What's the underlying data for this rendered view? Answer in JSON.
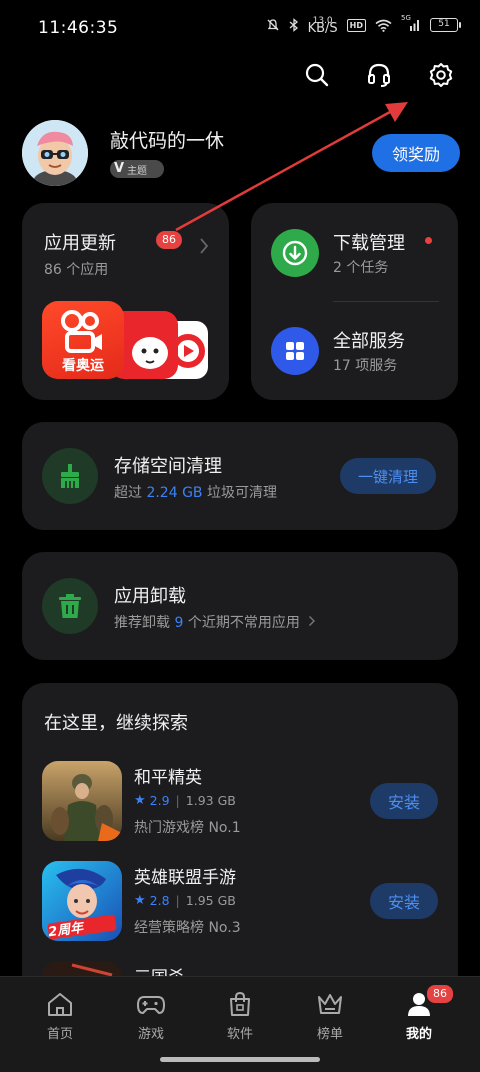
{
  "status_bar": {
    "time": "11:46:35",
    "net_speed_value": "13.0",
    "net_speed_unit": "KB/S",
    "hd": "HD",
    "net_type": "5G",
    "battery": "51"
  },
  "top_actions": {
    "icons": [
      "search-icon",
      "headset-icon",
      "gear-icon"
    ]
  },
  "profile": {
    "username": "敲代码的一休",
    "badge_letter": "V",
    "badge_label": "主题",
    "reward_button": "领奖励"
  },
  "updates_card": {
    "title": "应用更新",
    "count": "86",
    "subtitle": "86 个应用",
    "tile_text": "看奥运"
  },
  "downloads": {
    "title": "下载管理",
    "subtitle": "2 个任务"
  },
  "services": {
    "title": "全部服务",
    "subtitle": "17 项服务"
  },
  "storage": {
    "title": "存储空间清理",
    "sub_prefix": "超过",
    "sub_value": "2.24 GB",
    "sub_suffix": "垃圾可清理",
    "button": "一键清理"
  },
  "uninstall": {
    "title": "应用卸载",
    "sub_prefix": "推荐卸载",
    "sub_value": "9",
    "sub_suffix": "个近期不常用应用"
  },
  "explore": {
    "title": "在这里，继续探索",
    "games": [
      {
        "name": "和平精英",
        "rating": "2.9",
        "size": "1.93 GB",
        "rank": "热门游戏榜 No.1",
        "button": "安装"
      },
      {
        "name": "英雄联盟手游",
        "rating": "2.8",
        "size": "1.95 GB",
        "rank": "经营策略榜 No.3",
        "button": "安装"
      },
      {
        "name": "三国杀"
      }
    ],
    "lol_badge": "2周年"
  },
  "bottom_nav": {
    "items": [
      {
        "label": "首页",
        "icon": "home-icon"
      },
      {
        "label": "游戏",
        "icon": "gamepad-icon"
      },
      {
        "label": "软件",
        "icon": "shopping-bag-icon"
      },
      {
        "label": "榜单",
        "icon": "crown-icon"
      },
      {
        "label": "我的",
        "icon": "user-icon",
        "badge": "86"
      }
    ],
    "active_index": 4
  },
  "colors": {
    "accent": "#1f6fe5",
    "badge_red": "#e54242",
    "download_green": "#2eaa4a",
    "services_blue": "#2f59e8"
  }
}
